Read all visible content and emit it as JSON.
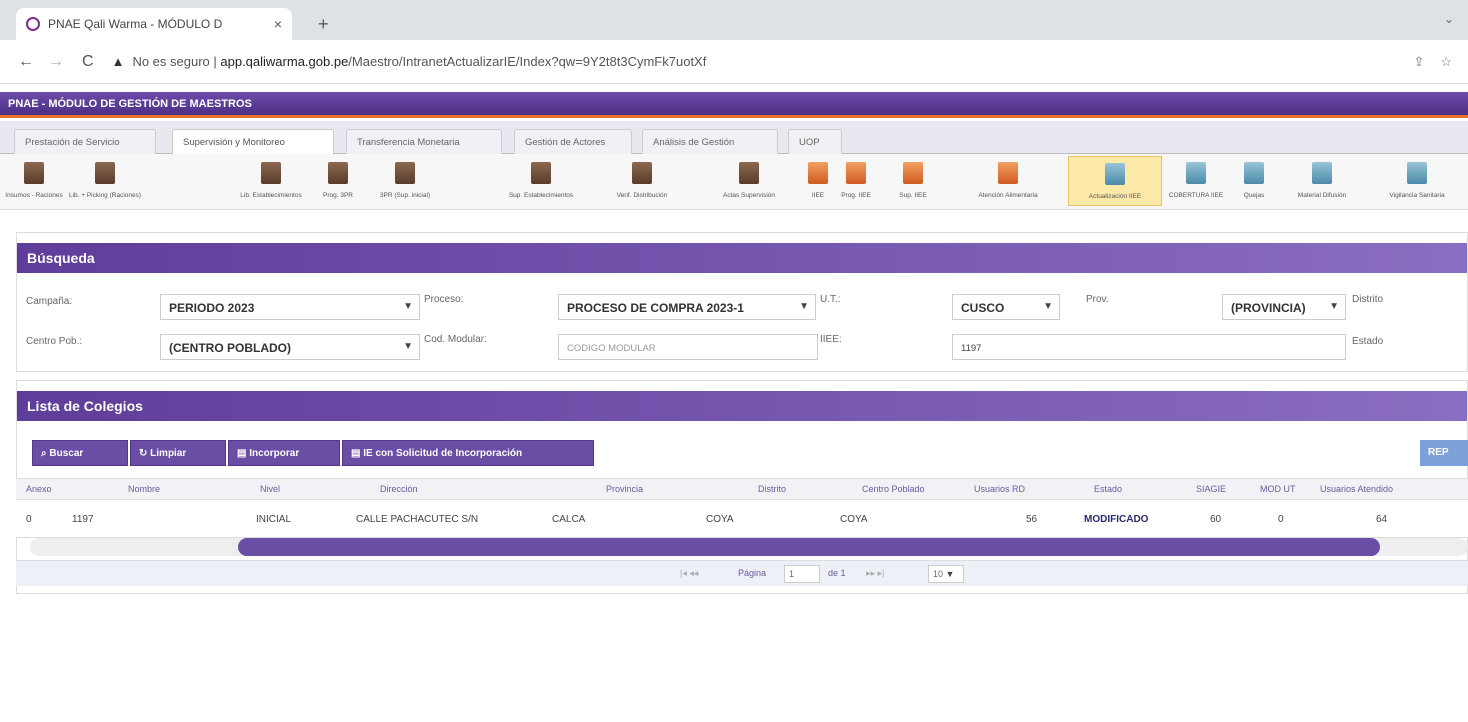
{
  "browser": {
    "tab_title": "PNAE Qali Warma - MÓDULO D",
    "tab_close": "×",
    "new_tab": "+",
    "tab_menu": "⌄",
    "back": "←",
    "forward": "→",
    "reload": "C",
    "security_label": "No es seguro",
    "url_host": "app.qaliwarma.gob.pe",
    "url_path": "/Maestro/IntranetActualizarIE/Index?qw=9Y2t8t3CymFk7uotXf",
    "share_icon": "⇪",
    "star_icon": "☆"
  },
  "app": {
    "title": "PNAE - MÓDULO DE GESTIÓN DE MAESTROS",
    "accent": "#5b3b99",
    "highlight": "#e8732a"
  },
  "menu_tabs": [
    "Prestación de Servicio",
    "Supervisión y Monitoreo",
    "Transferencia Monetaria",
    "Gestión de Actores",
    "Análisis de Gestión",
    "UOP"
  ],
  "toolbar": [
    {
      "label": "Insumos - Raciones",
      "icon": "building-icon"
    },
    {
      "label": "Lib. + Picking (Raciones)",
      "icon": "building-icon"
    },
    {
      "label": "Lib. Establecimientos",
      "icon": "building-icon"
    },
    {
      "label": "Prog. 3PR",
      "icon": "building-icon"
    },
    {
      "label": "3PR (Sup. inicial)",
      "icon": "building-icon"
    },
    {
      "label": "Sup. Establecimientos",
      "icon": "building-icon"
    },
    {
      "label": "Verif. Distribución",
      "icon": "building-icon"
    },
    {
      "label": "Actas Supervisión",
      "icon": "building-icon"
    },
    {
      "label": "IIEE",
      "icon": "box-icon"
    },
    {
      "label": "Prog. IIEE",
      "icon": "box-icon"
    },
    {
      "label": "Sup. IIEE",
      "icon": "box-icon"
    },
    {
      "label": "Atención Alimentaria",
      "icon": "box-icon"
    },
    {
      "label": "Actualización IIEE",
      "icon": "document-icon"
    },
    {
      "label": "COBERTURA IIEE",
      "icon": "document-icon"
    },
    {
      "label": "Quejas",
      "icon": "document-icon"
    },
    {
      "label": "Material Difusión",
      "icon": "document-icon"
    },
    {
      "label": "Vigilancia Sanitaria",
      "icon": "document-icon"
    }
  ],
  "busqueda": {
    "title": "Búsqueda",
    "campana_label": "Campaña:",
    "campana_value": "PERIODO 2023",
    "proceso_label": "Proceso:",
    "proceso_value": "PROCESO DE COMPRA 2023-1",
    "ut_label": "U.T.:",
    "ut_value": "CUSCO",
    "prov_label": "Prov.",
    "prov_value": "(PROVINCIA)",
    "distrito_label": "Distrito",
    "centro_label": "Centro Pob.:",
    "centro_value": "(CENTRO POBLADO)",
    "cod_modular_label": "Cod. Modular:",
    "cod_modular_placeholder": "CODIGO MODULAR",
    "iiee_label": "IIEE:",
    "iiee_value": "1197",
    "estado_label": "Estado"
  },
  "lista": {
    "title": "Lista de Colegios",
    "buttons": {
      "buscar": "Buscar",
      "limpiar": "Limpiar",
      "incorporar": "Incorporar",
      "solicitud": "IE con Solicitud de Incorporación",
      "rep": "REP"
    },
    "columns": [
      "Anexo",
      "Nombre",
      "Nivel",
      "Dirección",
      "Provincia",
      "Distrito",
      "Centro Poblado",
      "Usuarios RD",
      "Estado",
      "SIAGIE",
      "MOD UT",
      "Usuarios Atendido"
    ],
    "rows": [
      [
        "0",
        "1197",
        "INICIAL",
        "CALLE PACHACUTEC S/N",
        "CALCA",
        "COYA",
        "COYA",
        "56",
        "MODIFICADO",
        "60",
        "0",
        "64"
      ]
    ],
    "pager": {
      "nav_prev": "|◂ ◂◂",
      "page_label": "Página",
      "page_value": "1",
      "of_label": "de 1",
      "nav_next": "▸▸ ▸|",
      "per_page": "10"
    }
  }
}
